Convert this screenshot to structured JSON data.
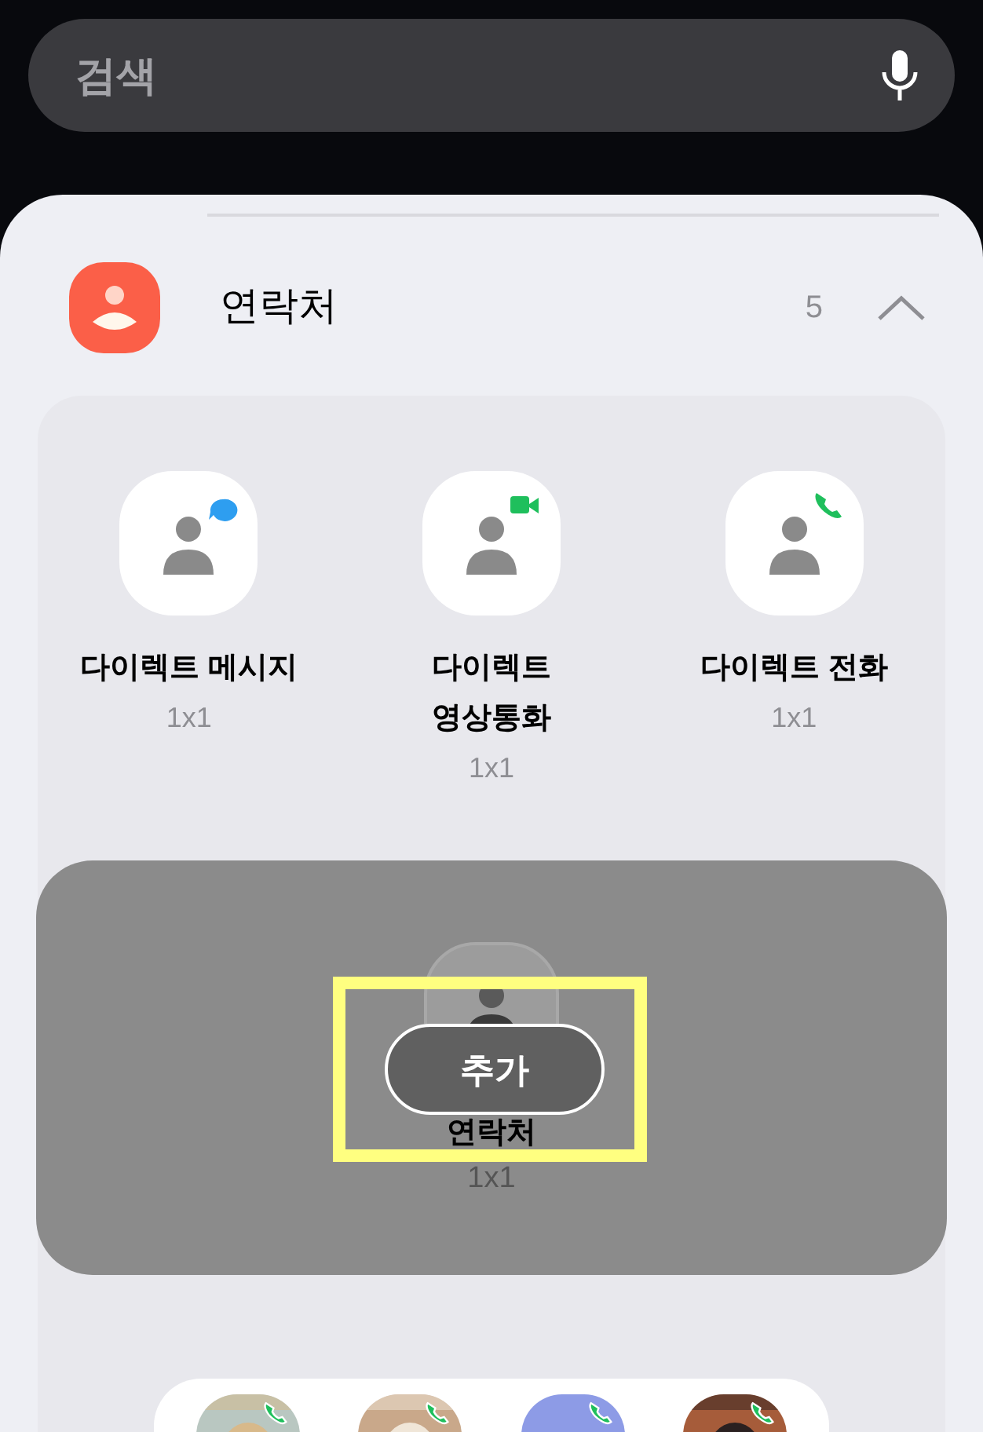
{
  "search": {
    "placeholder": "검색"
  },
  "section": {
    "title": "연락처",
    "count": "5",
    "expanded": true
  },
  "widgets": [
    {
      "kind": "message",
      "label": "다이렉트 메시지",
      "size": "1x1"
    },
    {
      "kind": "video",
      "label": "다이렉트\n영상통화",
      "size": "1x1"
    },
    {
      "kind": "call",
      "label": "다이렉트 전화",
      "size": "1x1"
    }
  ],
  "selected_widget": {
    "label": "연락처",
    "size": "1x1",
    "button": "추가"
  },
  "shortcuts": [
    {
      "kind": "picture"
    },
    {
      "kind": "picture"
    },
    {
      "kind": "default"
    },
    {
      "kind": "picture"
    }
  ]
}
